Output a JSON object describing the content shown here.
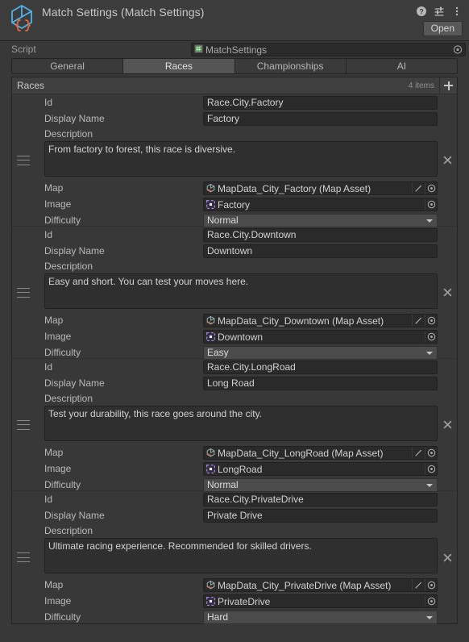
{
  "header": {
    "title": "Match Settings (Match Settings)",
    "icon": "scriptable-object-cube-icon",
    "help_icon": "help-icon",
    "preset_icon": "preset-settings-icon",
    "menu_icon": "more-menu-icon",
    "open_label": "Open"
  },
  "script_row": {
    "label": "Script",
    "value": "MatchSettings",
    "icon": "cs-script-icon",
    "picker_icon": "object-picker-icon"
  },
  "tabs": [
    {
      "label": "General",
      "active": false
    },
    {
      "label": "Races",
      "active": true
    },
    {
      "label": "Championships",
      "active": false
    },
    {
      "label": "AI",
      "active": false
    }
  ],
  "list": {
    "title": "Races",
    "count_label": "4 items",
    "add_icon": "plus-icon",
    "drag_icon": "drag-handle-icon",
    "remove_icon": "remove-x-icon",
    "labels": {
      "id": "Id",
      "display_name": "Display Name",
      "description": "Description",
      "map": "Map",
      "image": "Image",
      "difficulty": "Difficulty"
    },
    "map_icon": "map-asset-icon",
    "image_icon": "sprite-asset-icon",
    "edit_icon": "pencil-edit-icon",
    "picker_icon": "object-picker-icon",
    "caret_icon": "chevron-down-icon",
    "items": [
      {
        "id": "Race.City.Factory",
        "display_name": "Factory",
        "description": "From factory to forest, this race is diversive.",
        "map": "MapData_City_Factory (Map Asset)",
        "image": "Factory",
        "difficulty": "Normal"
      },
      {
        "id": "Race.City.Downtown",
        "display_name": "Downtown",
        "description": "Easy and short. You can test your moves here.",
        "map": "MapData_City_Downtown (Map Asset)",
        "image": "Downtown",
        "difficulty": "Easy"
      },
      {
        "id": "Race.City.LongRoad",
        "display_name": "Long Road",
        "description": "Test your durability, this race goes around the city.",
        "map": "MapData_City_LongRoad (Map Asset)",
        "image": "LongRoad",
        "difficulty": "Normal"
      },
      {
        "id": "Race.City.PrivateDrive",
        "display_name": "Private Drive",
        "description": "Ultimate racing experience. Recommended for skilled drivers.",
        "map": "MapData_City_PrivateDrive (Map Asset)",
        "image": "PrivateDrive",
        "difficulty": "Hard"
      }
    ]
  },
  "colors": {
    "window_bg": "#383838",
    "header_bg": "#3c3c3c",
    "field_bg": "#2a2a2a",
    "tab_active": "#545454",
    "accent_blue": "#4fb3e8",
    "accent_orange": "#e8663d"
  }
}
